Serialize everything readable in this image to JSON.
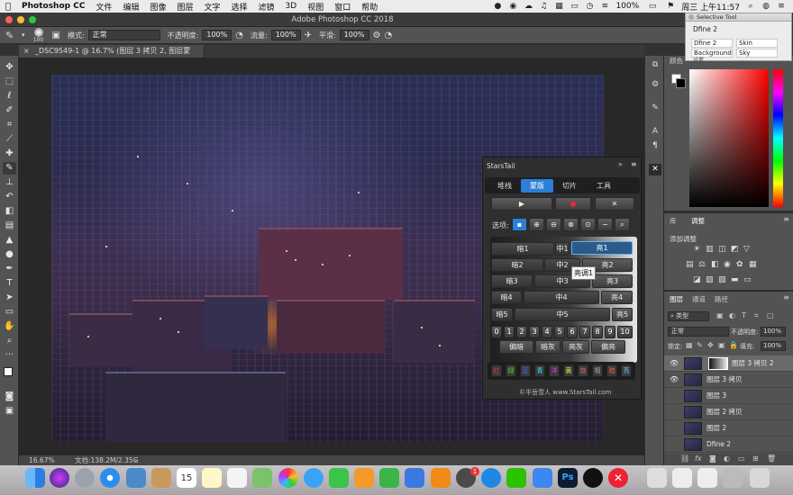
{
  "menubar": {
    "apple": "",
    "app": "Photoshop CC",
    "items": [
      "文件",
      "编辑",
      "图像",
      "图层",
      "文字",
      "选择",
      "滤镜",
      "3D",
      "视图",
      "窗口",
      "帮助"
    ],
    "battery": "100%",
    "clock": "周三 上午11:57"
  },
  "window": {
    "title": "Adobe Photoshop CC 2018"
  },
  "options": {
    "brush_size": "100",
    "mode_label": "模式:",
    "mode_value": "正常",
    "opacity_label": "不透明度:",
    "opacity_value": "100%",
    "flow_label": "流量:",
    "flow_value": "100%",
    "smooth_label": "平滑:",
    "smooth_value": "100%"
  },
  "document": {
    "tab": "_DSC9549-1 @ 16.7% (图层 3 拷贝 2, 图层蒙版/16) *",
    "zoom": "16.67%",
    "docsize": "文档:138.2M/2.35G"
  },
  "selective_tool": {
    "title": "Selective Tool",
    "heading": "Dfine 2",
    "rows": [
      [
        "Dfine 2",
        "Skin"
      ],
      [
        "Background",
        "Sky"
      ]
    ],
    "footer": "设置"
  },
  "color_panel": {
    "tab": "颜色"
  },
  "adjust_panel": {
    "tabs": [
      "库",
      "调整"
    ],
    "add_label": "添加调整"
  },
  "layers_panel": {
    "tabs": [
      "图层",
      "通道",
      "路径"
    ],
    "kind_label": "类型",
    "blend": "正常",
    "opacity_label": "不透明度:",
    "opacity_value": "100%",
    "lock_label": "锁定:",
    "fill_label": "填充:",
    "fill_value": "100%",
    "layers": [
      {
        "name": "图层 3 拷贝 2",
        "visible": true,
        "selected": true,
        "mask": true
      },
      {
        "name": "图层 3 拷贝",
        "visible": true,
        "selected": false,
        "mask": false
      },
      {
        "name": "图层 3",
        "visible": false,
        "selected": false,
        "mask": false
      },
      {
        "name": "图层 2 拷贝",
        "visible": false,
        "selected": false,
        "mask": false
      },
      {
        "name": "图层 2",
        "visible": false,
        "selected": false,
        "mask": false
      },
      {
        "name": "Dfine 2",
        "visible": false,
        "selected": false,
        "mask": false
      }
    ]
  },
  "starstail": {
    "title": "StarsTail",
    "tabs": [
      "堆栈",
      "蒙版",
      "切片",
      "工具"
    ],
    "active_tab": "蒙版",
    "options_label": "选项:",
    "rows": [
      [
        "暗1",
        "中1",
        "亮1"
      ],
      [
        "暗2",
        "中2",
        "亮2"
      ],
      [
        "暗3",
        "中3",
        "亮3"
      ],
      [
        "暗4",
        "中4",
        "亮4"
      ],
      [
        "暗5",
        "中5",
        "亮5"
      ]
    ],
    "tooltip": "亮调1",
    "numbers": [
      "0",
      "1",
      "2",
      "3",
      "4",
      "5",
      "6",
      "7",
      "8",
      "9",
      "10"
    ],
    "bottom": [
      "偏暗",
      "暗灰",
      "亮灰",
      "偏亮"
    ],
    "colors": [
      "红",
      "绿",
      "蓝",
      "青",
      "洋",
      "黄",
      "饱",
      "相",
      "暗",
      "亮"
    ],
    "footer": "©半岳雪人 www.StarsTail.com"
  },
  "dock": {
    "calendar_day": "15",
    "badge": "1"
  },
  "colors": {
    "accent": "#2b7fd6",
    "panel": "#535353"
  }
}
